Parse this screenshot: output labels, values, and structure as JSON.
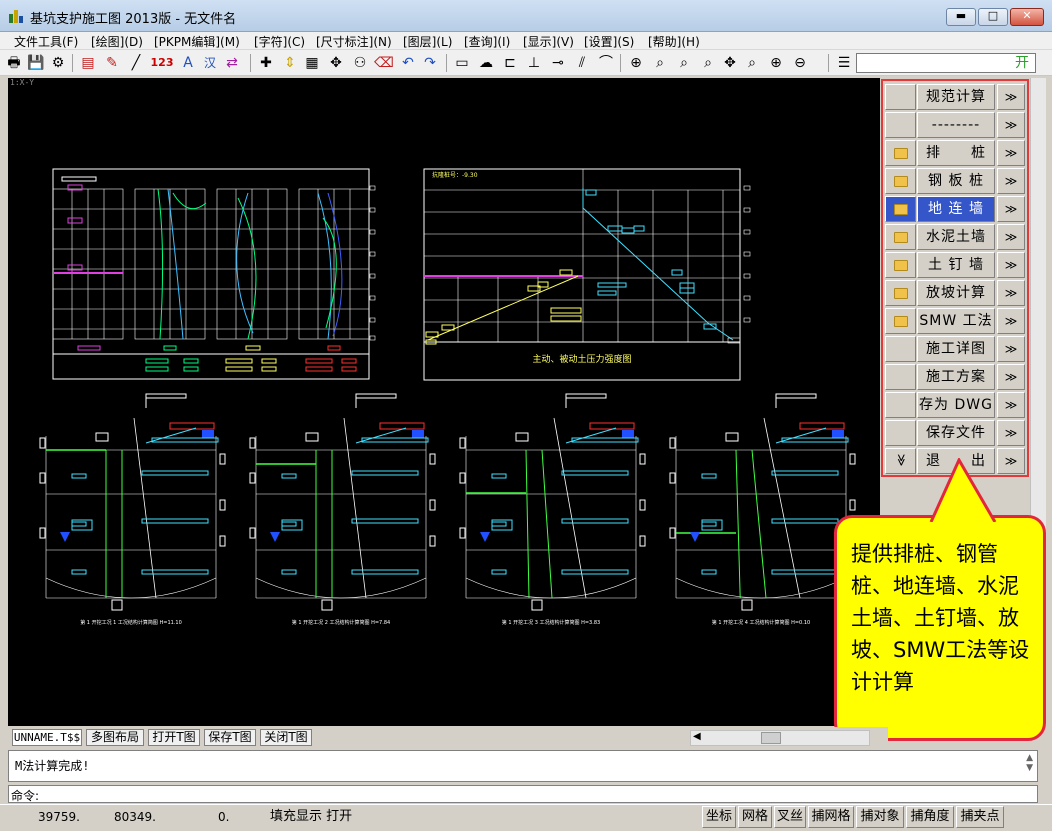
{
  "window": {
    "title": "基坑支护施工图 2013版 - 无文件名",
    "min": "▬",
    "max": "□",
    "close": "✕"
  },
  "menu": [
    "文件工具(F)",
    "[绘图](D)",
    "[PKPM编辑](M)",
    "[字符](C)",
    "[尺寸标注](N)",
    "[图层](L)",
    "[查询](I)",
    "[显示](V)",
    "[设置](S)",
    "[帮助](H)"
  ],
  "toolbar": {
    "text_123": "123",
    "text_han": "汉",
    "command_value": "开"
  },
  "canvas": {
    "corner_tag": "1:X-Y",
    "chart2_tag": "抗隆桩号：-9.30",
    "chart2_caption": "主动、被动土压力强度图",
    "section_captions": [
      "第 1 开挖工况 1 工况结构计算简图  H=11.10",
      "第 1 开挖工况 2 工况结构计算简图  H=7.84",
      "第 1 开挖工况 3 工况结构计算简图  H=3.83",
      "第 1 开挖工况 4 工况结构计算简图  H=0.10"
    ]
  },
  "sidebar": {
    "items": [
      {
        "label": "规范计算",
        "icon": "none",
        "active": false
      },
      {
        "label": "--------",
        "icon": "none",
        "active": false
      },
      {
        "label": "排　　桩",
        "icon": "folder-icon",
        "active": false
      },
      {
        "label": "钢 板 桩",
        "icon": "folder-icon",
        "active": false
      },
      {
        "label": "地 连 墙",
        "icon": "folder-icon",
        "active": true
      },
      {
        "label": "水泥土墙",
        "icon": "folder-icon",
        "active": false
      },
      {
        "label": "土 钉 墙",
        "icon": "folder-icon",
        "active": false
      },
      {
        "label": "放坡计算",
        "icon": "folder-icon",
        "active": false
      },
      {
        "label": "SMW 工法",
        "icon": "folder-icon",
        "active": false
      },
      {
        "label": "施工详图",
        "icon": "none",
        "active": false
      },
      {
        "label": "施工方案",
        "icon": "none",
        "active": false
      },
      {
        "label": "存为 DWG",
        "icon": "none",
        "active": false
      },
      {
        "label": "保存文件",
        "icon": "none",
        "active": false
      },
      {
        "label": "退　　出",
        "icon": "double-chevron-down-icon",
        "active": false
      }
    ],
    "arrow": "≫",
    "down_chevron": "≫"
  },
  "callout": {
    "text": "提供排桩、钢管桩、地连墙、水泥土墙、土钉墙、放坡、SMW工法等设计计算"
  },
  "tabs": [
    "UNNAME.T$$",
    "多图布局",
    "打开T图",
    "保存T图",
    "关闭T图"
  ],
  "output": {
    "message": "M法计算完成!"
  },
  "cmdline": {
    "label": "命令:"
  },
  "status": {
    "x": "39759.",
    "y": "80349.",
    "z": "0.",
    "fill": "填充显示 打开",
    "buttons": [
      "坐标",
      "网格",
      "叉丝",
      "捕网格",
      "捕对象",
      "捕角度",
      "捕夹点"
    ]
  },
  "colors": {
    "canvas_bg": "#000000",
    "active_item": "#3456c8",
    "callout_fill": "#ffff00",
    "callout_border": "#e2273a"
  }
}
